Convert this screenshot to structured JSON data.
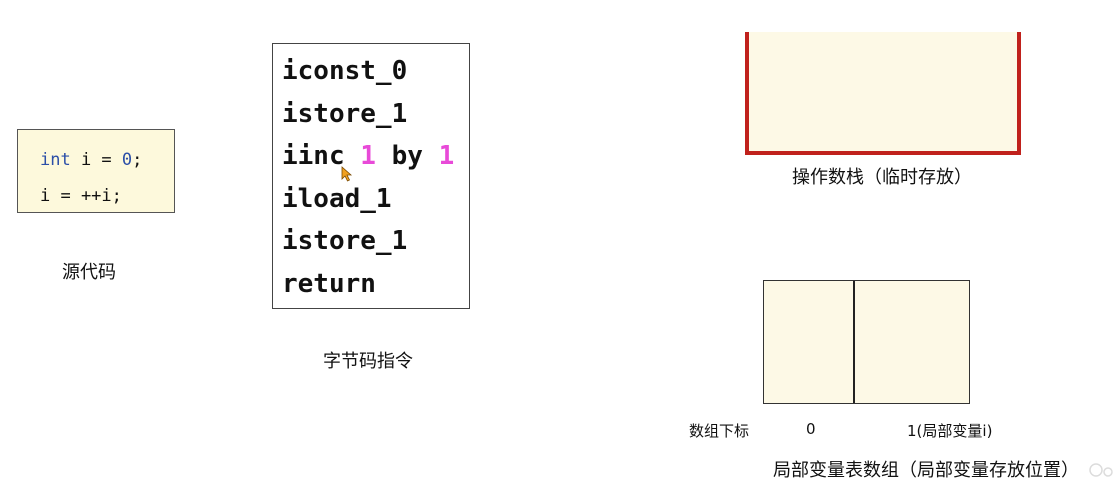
{
  "source": {
    "lines": [
      {
        "kw": "int",
        "rest": " i = ",
        "num": "0",
        "tail": ";"
      },
      {
        "plain": "i = ++i;"
      }
    ],
    "caption": "源代码"
  },
  "bytecode": {
    "lines": [
      {
        "text": "iconst_0"
      },
      {
        "text": "istore_1"
      },
      {
        "op": "iinc ",
        "a": "1",
        "mid": " by ",
        "b": "1"
      },
      {
        "text": "iload_1"
      },
      {
        "text": "istore_1"
      },
      {
        "text": "return"
      }
    ],
    "caption": "字节码指令"
  },
  "operand_stack": {
    "caption": "操作数栈（临时存放）"
  },
  "local_var_table": {
    "index_label": "数组下标",
    "index0": "0",
    "index1": "1(局部变量i)",
    "caption": "局部变量表数组（局部变量存放位置）"
  },
  "colors": {
    "code_bg": "#fdf9dc",
    "keyword_blue": "#2c4fa8",
    "bytecode_magenta": "#e84ad8",
    "stack_border": "#c0211c",
    "cell_bg": "#fdf9e6"
  },
  "icons": {
    "cursor": "arrow-cursor-icon"
  }
}
